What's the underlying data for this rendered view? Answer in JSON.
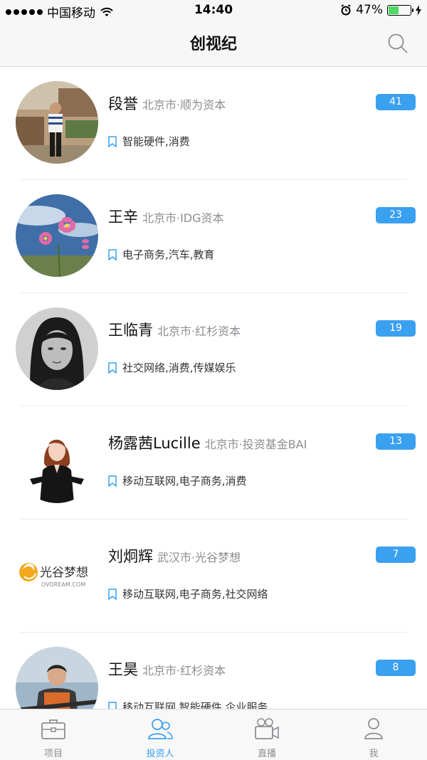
{
  "status_bar": {
    "carrier": "中国移动",
    "time": "14:40",
    "battery": "47%"
  },
  "nav": {
    "title": "创视纪"
  },
  "investors": [
    {
      "name": "段誉",
      "org": "北京市·顺为资本",
      "count": "41",
      "tags": "智能硬件,消费"
    },
    {
      "name": "王辛",
      "org": "北京市·IDG资本",
      "count": "23",
      "tags": "电子商务,汽车,教育"
    },
    {
      "name": "王临青",
      "org": "北京市·红杉资本",
      "count": "19",
      "tags": "社交网络,消费,传媒娱乐"
    },
    {
      "name": "杨露茜Lucille",
      "org": "北京市·投资基金BAI",
      "count": "13",
      "tags": "移动互联网,电子商务,消费"
    },
    {
      "name": "刘炯辉",
      "org": "武汉市·光谷梦想",
      "count": "7",
      "tags": "移动互联网,电子商务,社交网络"
    },
    {
      "name": "王昊",
      "org": "北京市·红杉资本",
      "count": "8",
      "tags": "移动互联网,智能硬件,企业服务"
    }
  ],
  "logo": {
    "cn": "光谷梦想",
    "en": "OVDREAM.COM"
  },
  "tabs": [
    {
      "label": "项目",
      "icon": "briefcase-icon"
    },
    {
      "label": "投资人",
      "icon": "people-icon"
    },
    {
      "label": "直播",
      "icon": "video-camera-icon"
    },
    {
      "label": "我",
      "icon": "person-icon"
    }
  ],
  "colors": {
    "accent": "#3aa0f0",
    "battery": "#4cd964",
    "secondary_text": "#8e8e93"
  }
}
